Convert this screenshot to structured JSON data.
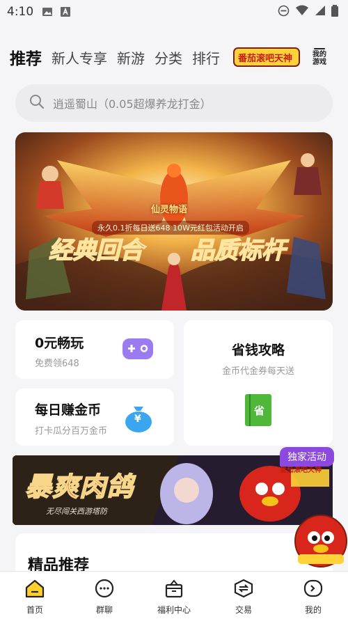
{
  "status": {
    "time": "4:10"
  },
  "tabs": [
    {
      "label": "推荐"
    },
    {
      "label": "新人专享"
    },
    {
      "label": "新游"
    },
    {
      "label": "分类"
    },
    {
      "label": "排行"
    }
  ],
  "tab_logo_text": "番茄滚吧天神",
  "my_games": {
    "line1": "我的",
    "line2": "游戏"
  },
  "search": {
    "placeholder": "逍遥蜀山（0.05超爆养龙打金）"
  },
  "banner": {
    "logo": "仙灵物语",
    "subtitle": "永久0.1折每日送648   10W元红包活动开启",
    "title_left": "经典回合",
    "title_right": "品质标杆"
  },
  "cards": {
    "free_play": {
      "title": "0元畅玩",
      "sub": "免费领648"
    },
    "save_money": {
      "title": "省钱攻略",
      "sub": "金币代金券每天送",
      "icon_text": "省"
    },
    "daily_coins": {
      "title": "每日赚金币",
      "sub": "打卡瓜分百万金币",
      "icon_text": "¥"
    }
  },
  "promo": {
    "title": "暴爽肉鸽",
    "sub": "无尽闯关西游塔防",
    "badge": "独家活动",
    "logo": "番茄滚吧天神"
  },
  "featured": {
    "title": "精品推荐"
  },
  "bottom_nav": [
    {
      "label": "首页"
    },
    {
      "label": "群聊"
    },
    {
      "label": "福利中心"
    },
    {
      "label": "交易"
    },
    {
      "label": "我的"
    }
  ],
  "colors": {
    "accent_purple": "#8c49e0",
    "save_green": "#4fb83a",
    "coin_blue": "#3aa6f0"
  }
}
